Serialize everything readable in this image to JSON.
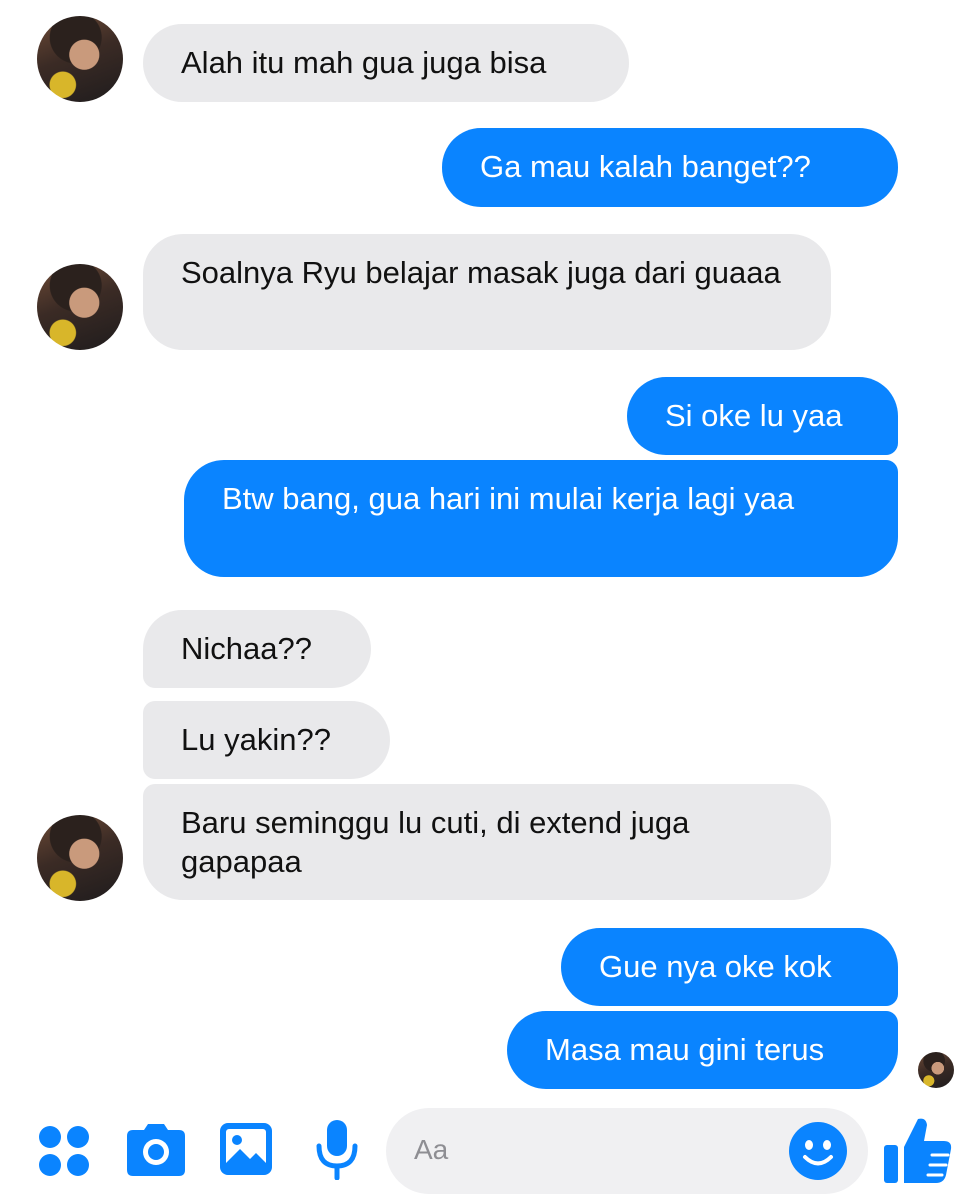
{
  "messages": [
    {
      "text": "Alah itu mah gua juga bisa"
    },
    {
      "text": "Ga mau kalah banget??"
    },
    {
      "text": "Soalnya Ryu belajar masak juga dari guaaa"
    },
    {
      "text": "Si oke lu yaa"
    },
    {
      "text": "Btw bang, gua hari ini mulai kerja lagi yaa"
    },
    {
      "text": "Nichaa??"
    },
    {
      "text": "Lu yakin??"
    },
    {
      "text": "Baru seminggu lu cuti, di extend juga gapapaa"
    },
    {
      "text": "Gue nya oke kok"
    },
    {
      "text": "Masa mau gini terus"
    }
  ],
  "composer": {
    "placeholder": "Aa",
    "icons": [
      "apps-icon",
      "camera-icon",
      "gallery-icon",
      "microphone-icon",
      "emoji-icon",
      "thumbs-up-icon"
    ]
  },
  "colors": {
    "outgoing": "#0a84ff",
    "incoming": "#e9e9eb",
    "accent": "#0a84ff"
  }
}
